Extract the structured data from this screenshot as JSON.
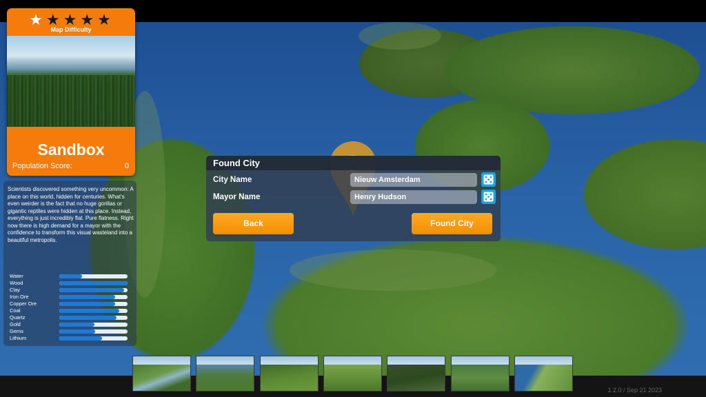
{
  "card": {
    "stars_total": 5,
    "stars_filled": 1,
    "difficulty_label": "Map Difficulty",
    "title": "Sandbox",
    "population_label": "Population Score:",
    "population_value": "0"
  },
  "description": "Scientists discovered something very uncommon: A place on this world, hidden for centuries. What's even weirder is the fact that no huge gorillas or gigantic reptiles were hidden at this place. Instead, everything is just incredibly flat. Pure flatness. Right now there is high demand for a mayor with the confidence to transform this visual wasteland into a beautiful metropolis.",
  "resources": [
    {
      "name": "Water",
      "level": 0.33
    },
    {
      "name": "Wood",
      "level": 1.0
    },
    {
      "name": "Clay",
      "level": 0.95
    },
    {
      "name": "Iron Ore",
      "level": 0.82
    },
    {
      "name": "Copper Ore",
      "level": 0.82
    },
    {
      "name": "Coal",
      "level": 0.88
    },
    {
      "name": "Quartz",
      "level": 0.84
    },
    {
      "name": "Gold",
      "level": 0.52
    },
    {
      "name": "Gems",
      "level": 0.53
    },
    {
      "name": "Lithium",
      "level": 0.63
    }
  ],
  "dialog": {
    "title": "Found City",
    "city_label": "City Name",
    "city_value": "Nieuw Amsterdam",
    "mayor_label": "Mayor Name",
    "mayor_value": "Henry Hudson",
    "back_label": "Back",
    "found_label": "Found City"
  },
  "thumbnails_count": 7,
  "version": "1.2.0 / Sep 21 2023",
  "colors": {
    "accent_orange": "#f57c0a",
    "button_orange": "#ffa821",
    "dice_blue": "#18a4de",
    "bar_blue": "#1f7ad6"
  }
}
